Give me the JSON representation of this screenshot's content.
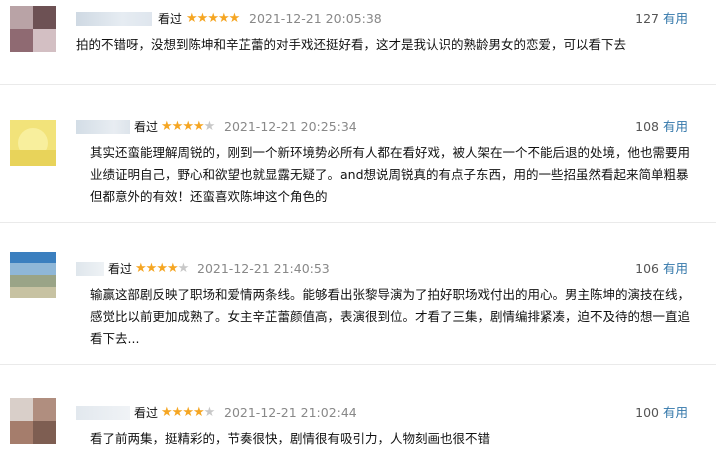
{
  "reviews": [
    {
      "meta_label": "看过",
      "stars": 5,
      "time": "2021-12-21 20:05:38",
      "votes": "127",
      "vote_label": "有用",
      "content": "拍的不错呀，没想到陈坤和辛芷蕾的对手戏还挺好看，这才是我认识的熟龄男女的恋爱，可以看下去"
    },
    {
      "meta_label": "看过",
      "stars": 4,
      "time": "2021-12-21 20:25:34",
      "votes": "108",
      "vote_label": "有用",
      "content": "其实还蛮能理解周锐的，刚到一个新环境势必所有人都在看好戏，被人架在一个不能后退的处境，他也需要用业绩证明自己，野心和欲望也就显露无疑了。and想说周锐真的有点子东西，用的一些招虽然看起来简单粗暴但都意外的有效！还蛮喜欢陈坤这个角色的"
    },
    {
      "meta_label": "看过",
      "stars": 4,
      "time": "2021-12-21 21:40:53",
      "votes": "106",
      "vote_label": "有用",
      "content": "输赢这部剧反映了职场和爱情两条线。能够看出张黎导演为了拍好职场戏付出的用心。男主陈坤的演技在线，感觉比以前更加成熟了。女主辛芷蕾颜值高，表演很到位。才看了三集，剧情编排紧凑，迫不及待的想一直追看下去..."
    },
    {
      "meta_label": "看过",
      "stars": 4,
      "time": "2021-12-21 21:02:44",
      "votes": "100",
      "vote_label": "有用",
      "content": "看了前两集，挺精彩的，节奏很快，剧情很有吸引力，人物刻画也很不错"
    }
  ],
  "colors": {
    "star": "#f5a623",
    "star_empty": "#c8c8c8",
    "link": "#3377aa",
    "time": "#888888"
  }
}
